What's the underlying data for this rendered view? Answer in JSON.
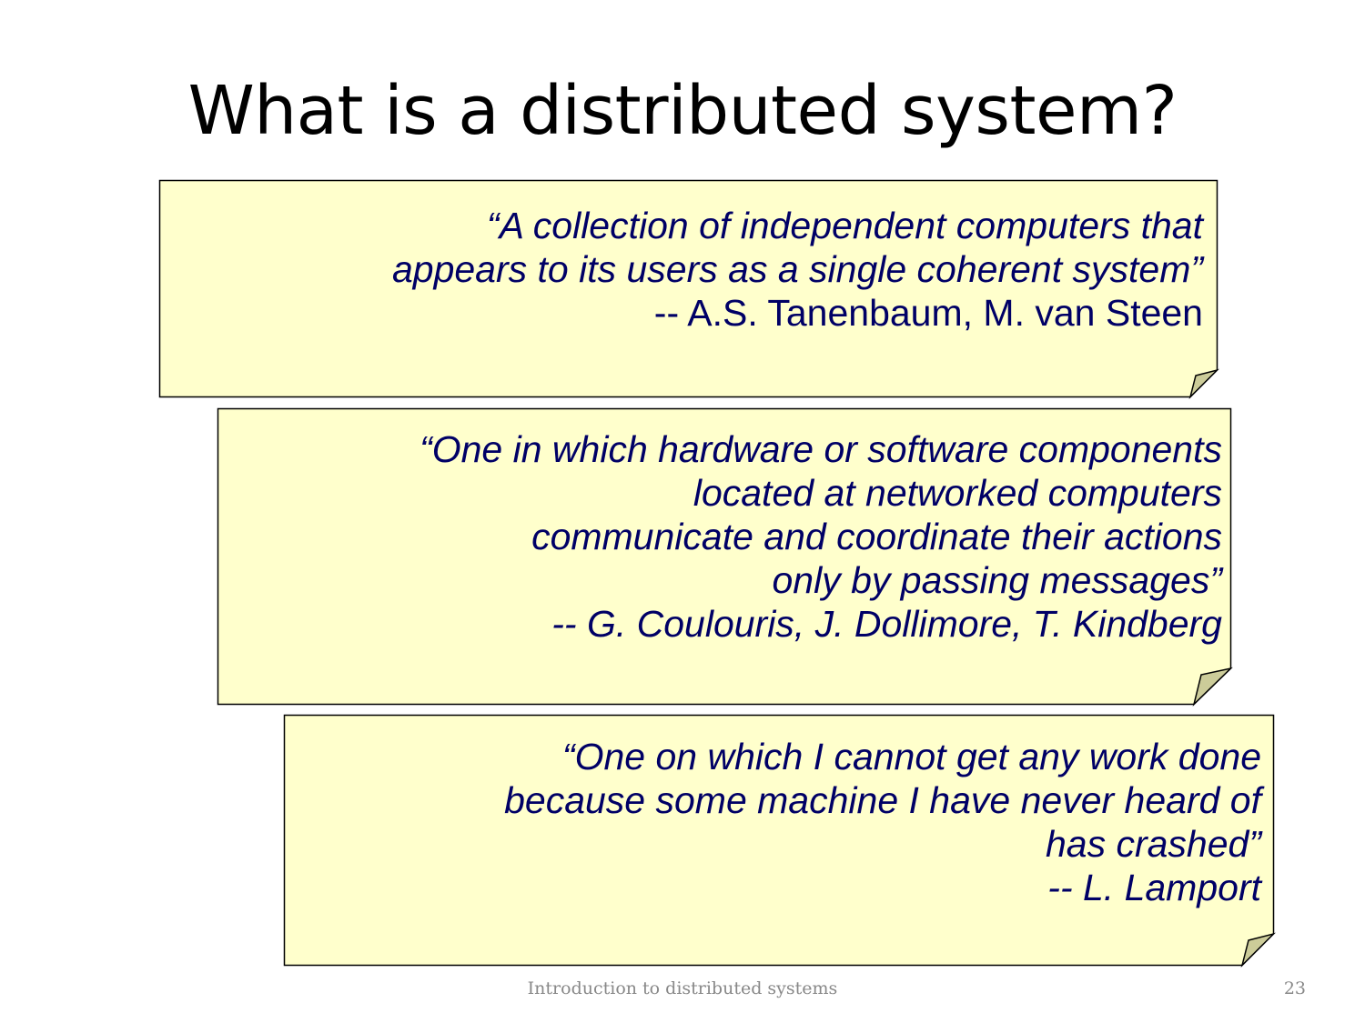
{
  "slide": {
    "title": "What is a distributed system?",
    "footer": "Introduction to distributed systems",
    "page_number": "23"
  },
  "colors": {
    "note_fill": "#ffffcc",
    "note_fold": "#cccc99",
    "note_border": "#000000",
    "quote_text": "#000066"
  },
  "quotes": [
    {
      "lines": [
        "“A collection of independent computers that ",
        "appears to its users as a single coherent system”"
      ],
      "attribution": "-- A.S. Tanenbaum, M. van Steen"
    },
    {
      "lines": [
        "“One in which hardware or software components",
        "located at networked computers ",
        "communicate and coordinate their actions ",
        "only by passing messages”"
      ],
      "attribution": "-- G. Coulouris, J. Dollimore, T. Kindberg"
    },
    {
      "lines": [
        "“One on which I cannot get any work done ",
        "because some machine I have never heard of ",
        "has crashed”"
      ],
      "attribution": "-- L. Lamport"
    }
  ]
}
